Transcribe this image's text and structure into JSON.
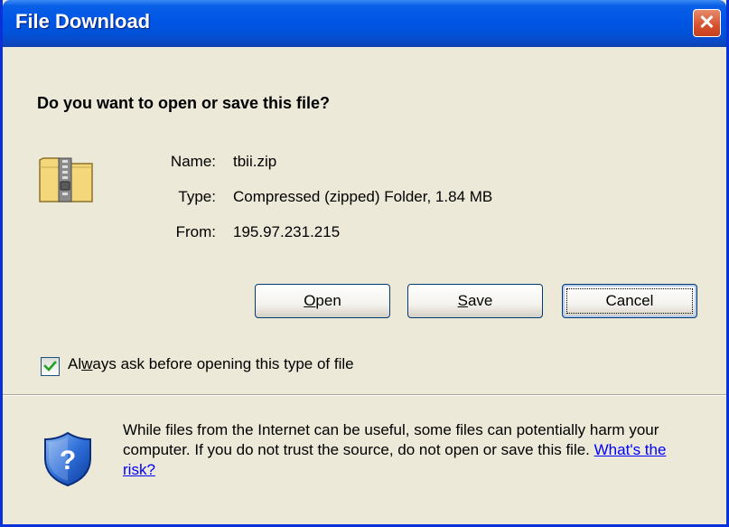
{
  "window": {
    "title": "File Download",
    "close_label": "✕"
  },
  "dialog": {
    "question": "Do you want to open or save this file?",
    "file": {
      "name_label": "Name:",
      "name_value": "tbii.zip",
      "type_label": "Type:",
      "type_value": "Compressed (zipped) Folder, 1.84 MB",
      "from_label": "From:",
      "from_value": "195.97.231.215",
      "icon": "zip-folder-icon"
    },
    "buttons": {
      "open": {
        "accel": "O",
        "rest": "pen"
      },
      "save": {
        "accel": "S",
        "rest": "ave"
      },
      "cancel": "Cancel"
    },
    "checkbox": {
      "checked": true,
      "label_pre": "Al",
      "label_accel": "w",
      "label_post": "ays ask before opening this type of file"
    },
    "warning": {
      "icon": "security-shield-icon",
      "text": "While files from the Internet can be useful, some files can potentially harm your computer. If you do not trust the source, do not open or save this file.",
      "link": "What's the risk?"
    }
  },
  "colors": {
    "titlebar": "#0055e5",
    "close_button": "#d7502c",
    "dialog_bg": "#ece9d8",
    "link": "#0000ff"
  }
}
